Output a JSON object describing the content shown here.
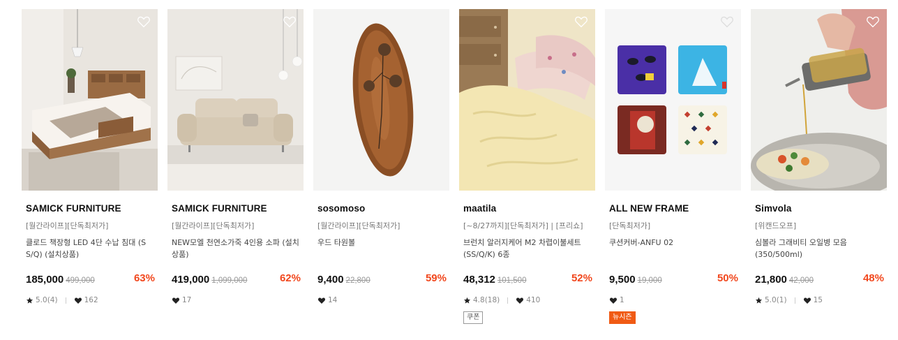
{
  "products": [
    {
      "brand": "SAMICK FURNITURE",
      "promo": "[월간라이프][단독최저가]",
      "title": "클로드 책장형 LED 4단 수납 침대 (S S/Q) (설치상품)",
      "price": "185,000",
      "original_price": "499,000",
      "discount": "63%",
      "rating": "5.0(4)",
      "likes": "162",
      "badge": "",
      "image": "bedroom-bed-photo"
    },
    {
      "brand": "SAMICK FURNITURE",
      "promo": "[월간라이프][단독최저가]",
      "title": "NEW모엘 천연소가죽 4인용 소파 (설치상품)",
      "price": "419,000",
      "original_price": "1,099,000",
      "discount": "62%",
      "rating": "",
      "likes": "17",
      "badge": "",
      "image": "beige-sofa-photo"
    },
    {
      "brand": "sosomoso",
      "promo": "[월간라이프][단독최저가]",
      "title": "우드 타원볼",
      "price": "9,400",
      "original_price": "22,800",
      "discount": "59%",
      "rating": "",
      "likes": "14",
      "badge": "",
      "image": "wood-oval-bowl-photo"
    },
    {
      "brand": "maatila",
      "promo": "[~8/27까지][단독최저가] | [프리쇼]",
      "title": "브런치 알러지케어 M2 차렵이불세트 (SS/Q/K) 6종",
      "price": "48,312",
      "original_price": "101,500",
      "discount": "52%",
      "rating": "4.8(18)",
      "likes": "410",
      "badge": "쿠폰",
      "badge_style": "outline",
      "image": "yellow-bedding-photo"
    },
    {
      "brand": "ALL NEW FRAME",
      "promo": "[단독최저가]",
      "title": "쿠션커버-ANFU 02",
      "price": "9,500",
      "original_price": "19,000",
      "discount": "50%",
      "rating": "",
      "likes": "1",
      "badge": "뉴시즌",
      "badge_style": "solid",
      "image": "cushion-covers-photo"
    },
    {
      "brand": "Simvola",
      "promo": "[위캔드오프]",
      "title": "심볼라 그래비티 오일병 모음 (350/500ml)",
      "price": "21,800",
      "original_price": "42,000",
      "discount": "48%",
      "rating": "5.0(1)",
      "likes": "15",
      "badge": "",
      "image": "oil-bottle-photo"
    }
  ],
  "icons": {
    "wishlist": "heart-outline-icon",
    "rating": "star-icon",
    "likes": "heart-filled-icon"
  },
  "colors": {
    "discount": "#f1471d",
    "new_season_badge": "#f05a14"
  }
}
